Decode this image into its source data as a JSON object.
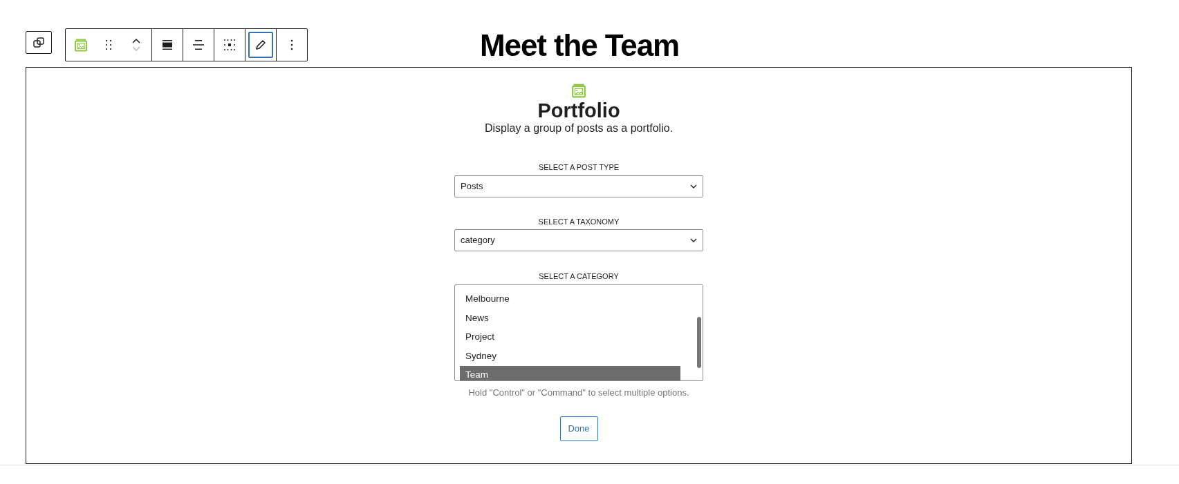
{
  "heading": "Meet the Team",
  "toolbar": {
    "tools": [
      {
        "kind": "block-icon",
        "selected": false
      },
      {
        "kind": "drag",
        "selected": false
      },
      {
        "kind": "move",
        "selected": false
      },
      {
        "kind": "align-wide",
        "selected": false
      },
      {
        "kind": "align-center",
        "selected": false
      },
      {
        "kind": "grid",
        "selected": false
      },
      {
        "kind": "edit",
        "selected": true
      },
      {
        "kind": "more",
        "selected": false
      }
    ]
  },
  "block": {
    "title": "Portfolio",
    "description": "Display a group of posts as a portfolio.",
    "post_type": {
      "label": "SELECT A POST TYPE",
      "value": "Posts"
    },
    "taxonomy": {
      "label": "SELECT A TAXONOMY",
      "value": "category"
    },
    "category": {
      "label": "SELECT A CATEGORY",
      "options": [
        {
          "label": "Melbourne",
          "selected": false
        },
        {
          "label": "News",
          "selected": false
        },
        {
          "label": "Project",
          "selected": false
        },
        {
          "label": "Sydney",
          "selected": false
        },
        {
          "label": "Team",
          "selected": true
        }
      ],
      "help": "Hold \"Control\" or \"Command\" to select multiple options."
    },
    "done": "Done"
  }
}
